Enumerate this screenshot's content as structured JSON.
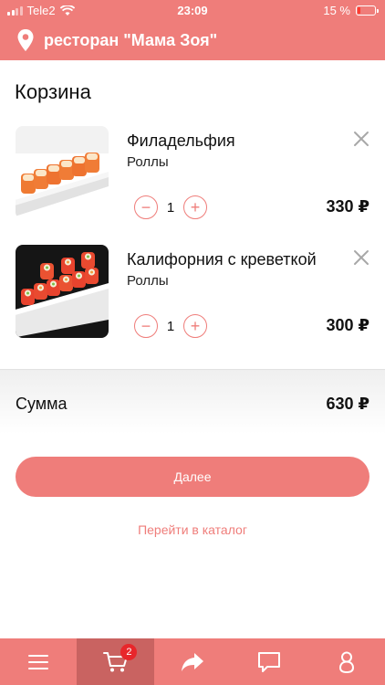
{
  "status_bar": {
    "carrier": "Tele2",
    "time": "23:09",
    "battery": "15 %"
  },
  "header": {
    "title": "ресторан \"Мама Зоя\"",
    "icon": "location-pin-icon"
  },
  "page": {
    "title": "Корзина"
  },
  "cart": {
    "items": [
      {
        "name": "Филадельфия",
        "category": "Роллы",
        "quantity": "1",
        "price": "330 ₽",
        "minus": "−",
        "plus": "+"
      },
      {
        "name": "Калифорния с креветкой",
        "category": "Роллы",
        "quantity": "1",
        "price": "300 ₽",
        "minus": "−",
        "plus": "+"
      }
    ]
  },
  "summary": {
    "label": "Сумма",
    "total": "630 ₽"
  },
  "actions": {
    "next_label": "Далее",
    "catalog_link": "Перейти в каталог"
  },
  "tabbar": {
    "tabs": [
      {
        "icon": "menu-icon"
      },
      {
        "icon": "cart-icon",
        "badge": "2",
        "active": true
      },
      {
        "icon": "share-icon"
      },
      {
        "icon": "chat-icon"
      },
      {
        "icon": "profile-icon"
      }
    ]
  },
  "colors": {
    "accent": "#ef7d7a",
    "accent_dark": "#c96361",
    "badge": "#e8262b"
  }
}
